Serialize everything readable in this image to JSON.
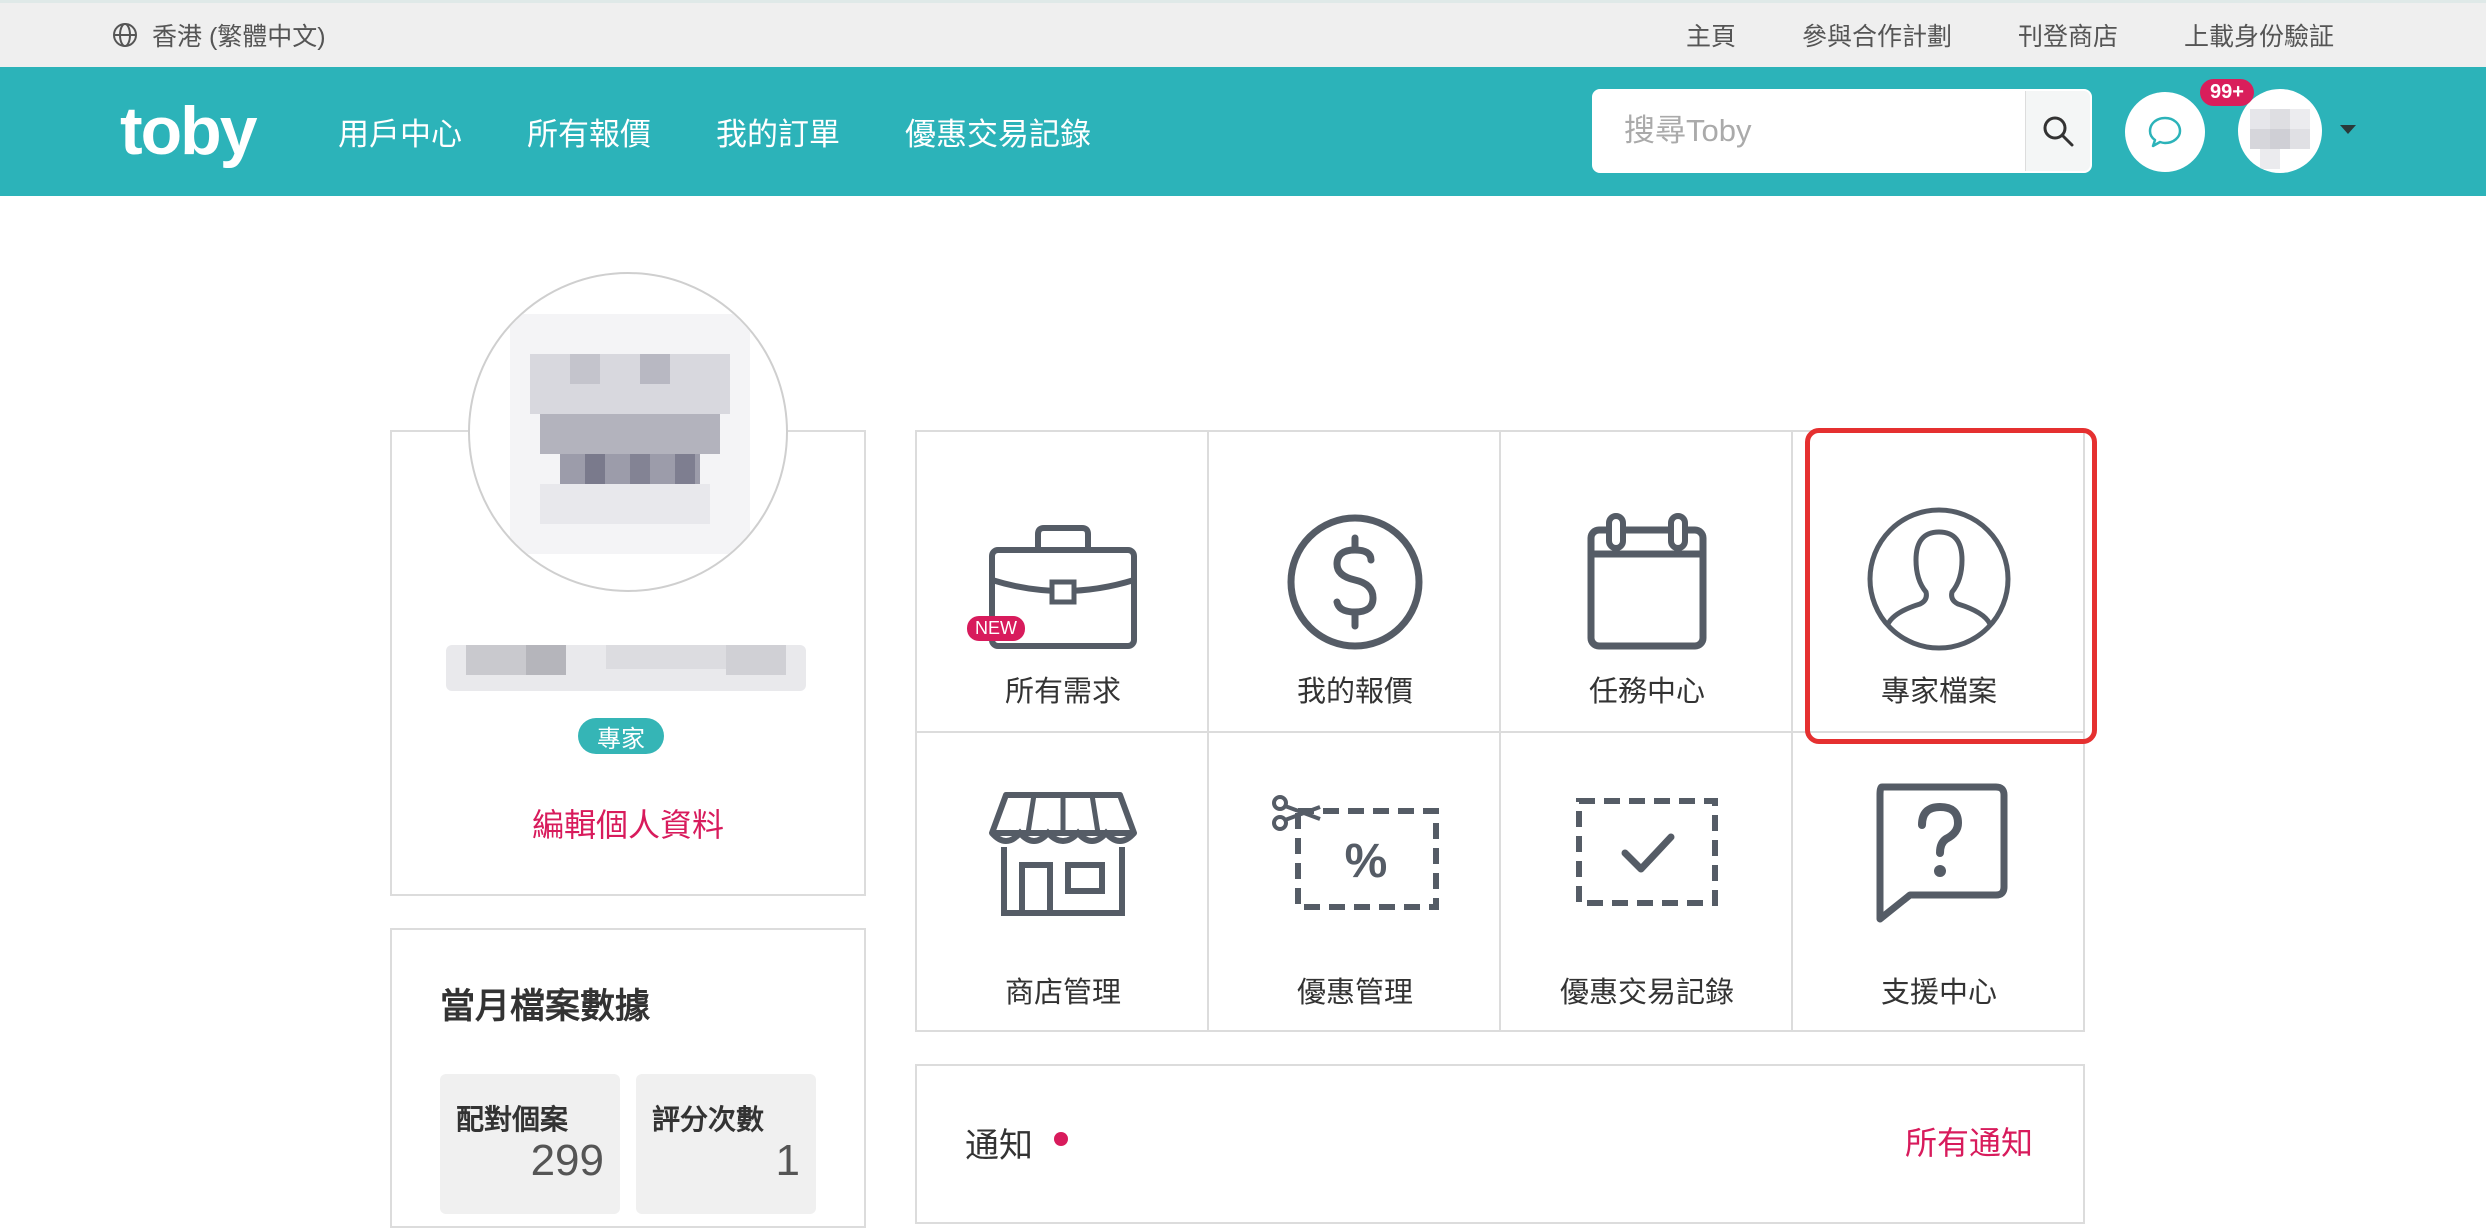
{
  "topbar": {
    "language": "香港 (繁體中文)",
    "links": [
      "主頁",
      "參與合作計劃",
      "刊登商店",
      "上載身份驗証"
    ]
  },
  "nav": {
    "logo": "toby",
    "links": [
      "用戶中心",
      "所有報價",
      "我的訂單",
      "優惠交易記錄"
    ],
    "search_placeholder": "搜尋Toby",
    "badge": "99+"
  },
  "profile": {
    "tag": "專家",
    "edit_link": "編輯個人資料"
  },
  "stats": {
    "title": "當月檔案數據",
    "items": [
      {
        "label": "配對個案",
        "value": "299"
      },
      {
        "label": "評分次數",
        "value": "1"
      }
    ]
  },
  "grid": {
    "new_badge": "NEW",
    "items": [
      {
        "label": "所有需求",
        "icon": "briefcase-icon"
      },
      {
        "label": "我的報價",
        "icon": "dollar-icon"
      },
      {
        "label": "任務中心",
        "icon": "calendar-icon"
      },
      {
        "label": "專家檔案",
        "icon": "person-icon"
      },
      {
        "label": "商店管理",
        "icon": "shop-icon"
      },
      {
        "label": "優惠管理",
        "icon": "coupon-icon"
      },
      {
        "label": "優惠交易記錄",
        "icon": "check-box-icon"
      },
      {
        "label": "支援中心",
        "icon": "help-icon"
      }
    ]
  },
  "notifications": {
    "title": "通知",
    "all_link": "所有通知"
  },
  "colors": {
    "brand": "#2cb3b9",
    "accent": "#d81b5c",
    "highlight": "#e53030"
  }
}
